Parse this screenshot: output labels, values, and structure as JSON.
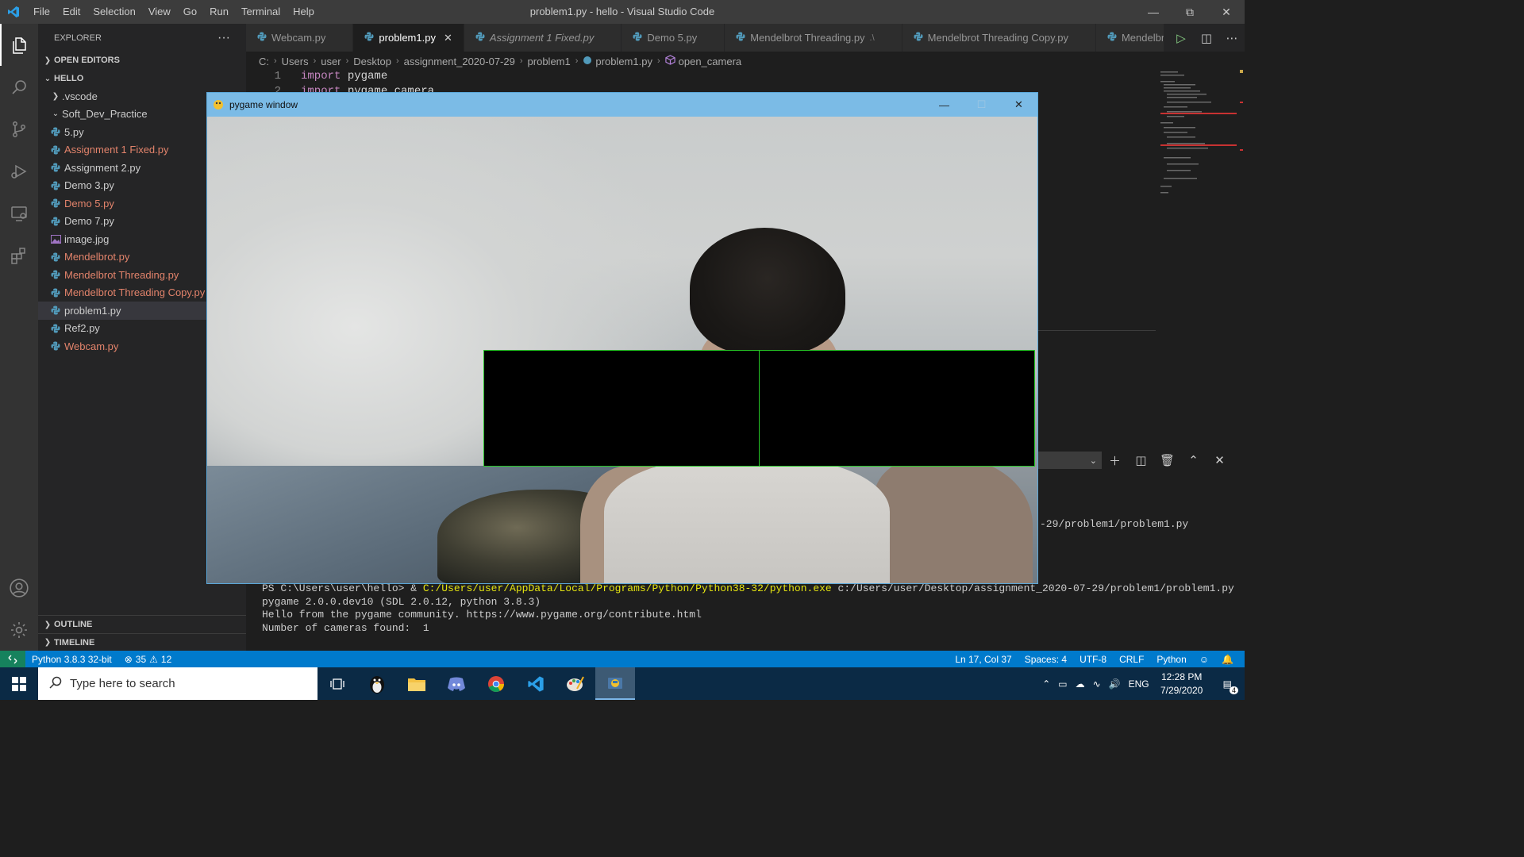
{
  "window": {
    "title": "problem1.py - hello - Visual Studio Code",
    "menu": [
      "File",
      "Edit",
      "Selection",
      "View",
      "Go",
      "Run",
      "Terminal",
      "Help"
    ]
  },
  "explorer": {
    "header": "EXPLORER",
    "more": "···",
    "open_editors": "OPEN EDITORS",
    "folder": "HELLO",
    "items": [
      {
        "label": ".vscode",
        "kind": "folder-collapsed",
        "modified": false
      },
      {
        "label": "Soft_Dev_Practice",
        "kind": "folder-expanded",
        "modified": false
      },
      {
        "label": "5.py",
        "kind": "python",
        "modified": false
      },
      {
        "label": "Assignment 1 Fixed.py",
        "kind": "python",
        "modified": true
      },
      {
        "label": "Assignment 2.py",
        "kind": "python",
        "modified": false
      },
      {
        "label": "Demo 3.py",
        "kind": "python",
        "modified": false
      },
      {
        "label": "Demo 5.py",
        "kind": "python",
        "modified": true
      },
      {
        "label": "Demo 7.py",
        "kind": "python",
        "modified": false
      },
      {
        "label": "image.jpg",
        "kind": "image",
        "modified": false
      },
      {
        "label": "Mendelbrot.py",
        "kind": "python",
        "modified": true
      },
      {
        "label": "Mendelbrot Threading.py",
        "kind": "python",
        "modified": true
      },
      {
        "label": "Mendelbrot Threading Copy.py",
        "kind": "python",
        "modified": true
      },
      {
        "label": "problem1.py",
        "kind": "python",
        "modified": false,
        "selected": true
      },
      {
        "label": "Ref2.py",
        "kind": "python",
        "modified": false
      },
      {
        "label": "Webcam.py",
        "kind": "python",
        "modified": true
      }
    ],
    "outline": "OUTLINE",
    "timeline": "TIMELINE"
  },
  "tabs": [
    {
      "label": "Webcam.py",
      "active": false,
      "italic": false,
      "suffix": ""
    },
    {
      "label": "problem1.py",
      "active": true,
      "italic": false,
      "suffix": ""
    },
    {
      "label": "Assignment 1 Fixed.py",
      "active": false,
      "italic": true,
      "suffix": ""
    },
    {
      "label": "Demo 5.py",
      "active": false,
      "italic": false,
      "suffix": ""
    },
    {
      "label": "Mendelbrot Threading.py",
      "active": false,
      "italic": false,
      "suffix": ".\\"
    },
    {
      "label": "Mendelbrot Threading Copy.py",
      "active": false,
      "italic": false,
      "suffix": ""
    },
    {
      "label": "Mendelbrot",
      "active": false,
      "italic": false,
      "suffix": ""
    }
  ],
  "breadcrumb": [
    "C:",
    "Users",
    "user",
    "Desktop",
    "assignment_2020-07-29",
    "problem1",
    "problem1.py",
    "open_camera"
  ],
  "editor": {
    "lines": [
      {
        "num": "1",
        "keyword": "import",
        "text": " pygame"
      },
      {
        "num": "2",
        "keyword": "import",
        "text": " pygame.camera"
      }
    ]
  },
  "pygame": {
    "title": "pygame window",
    "rect_border_color": "#26c626"
  },
  "terminal": {
    "partial_path": "-29/problem1/problem1.py",
    "prompt": "PS C:\\Users\\user\\hello> & ",
    "exe": "C:/Users/user/AppData/Local/Programs/Python/Python38-32/python.exe",
    "script": " c:/Users/user/Desktop/assignment_2020-07-29/problem1/problem1.py",
    "line2": "pygame 2.0.0.dev10 (SDL 2.0.12, python 3.8.3)",
    "line3": "Hello from the pygame community. https://www.pygame.org/contribute.html",
    "line4": "Number of cameras found:  1"
  },
  "statusbar": {
    "interpreter": "Python 3.8.3 32-bit",
    "errors": "35",
    "warnings": "12",
    "position": "Ln 17, Col 37",
    "spaces": "Spaces: 4",
    "encoding": "UTF-8",
    "eol": "CRLF",
    "language": "Python"
  },
  "taskbar": {
    "search_placeholder": "Type here to search",
    "lang": "ENG",
    "time": "12:28 PM",
    "date": "7/29/2020",
    "notifications": "4"
  },
  "colors": {
    "accent": "#007acc",
    "modified": "#e2836b",
    "terminal_yellow": "#e5e510"
  }
}
